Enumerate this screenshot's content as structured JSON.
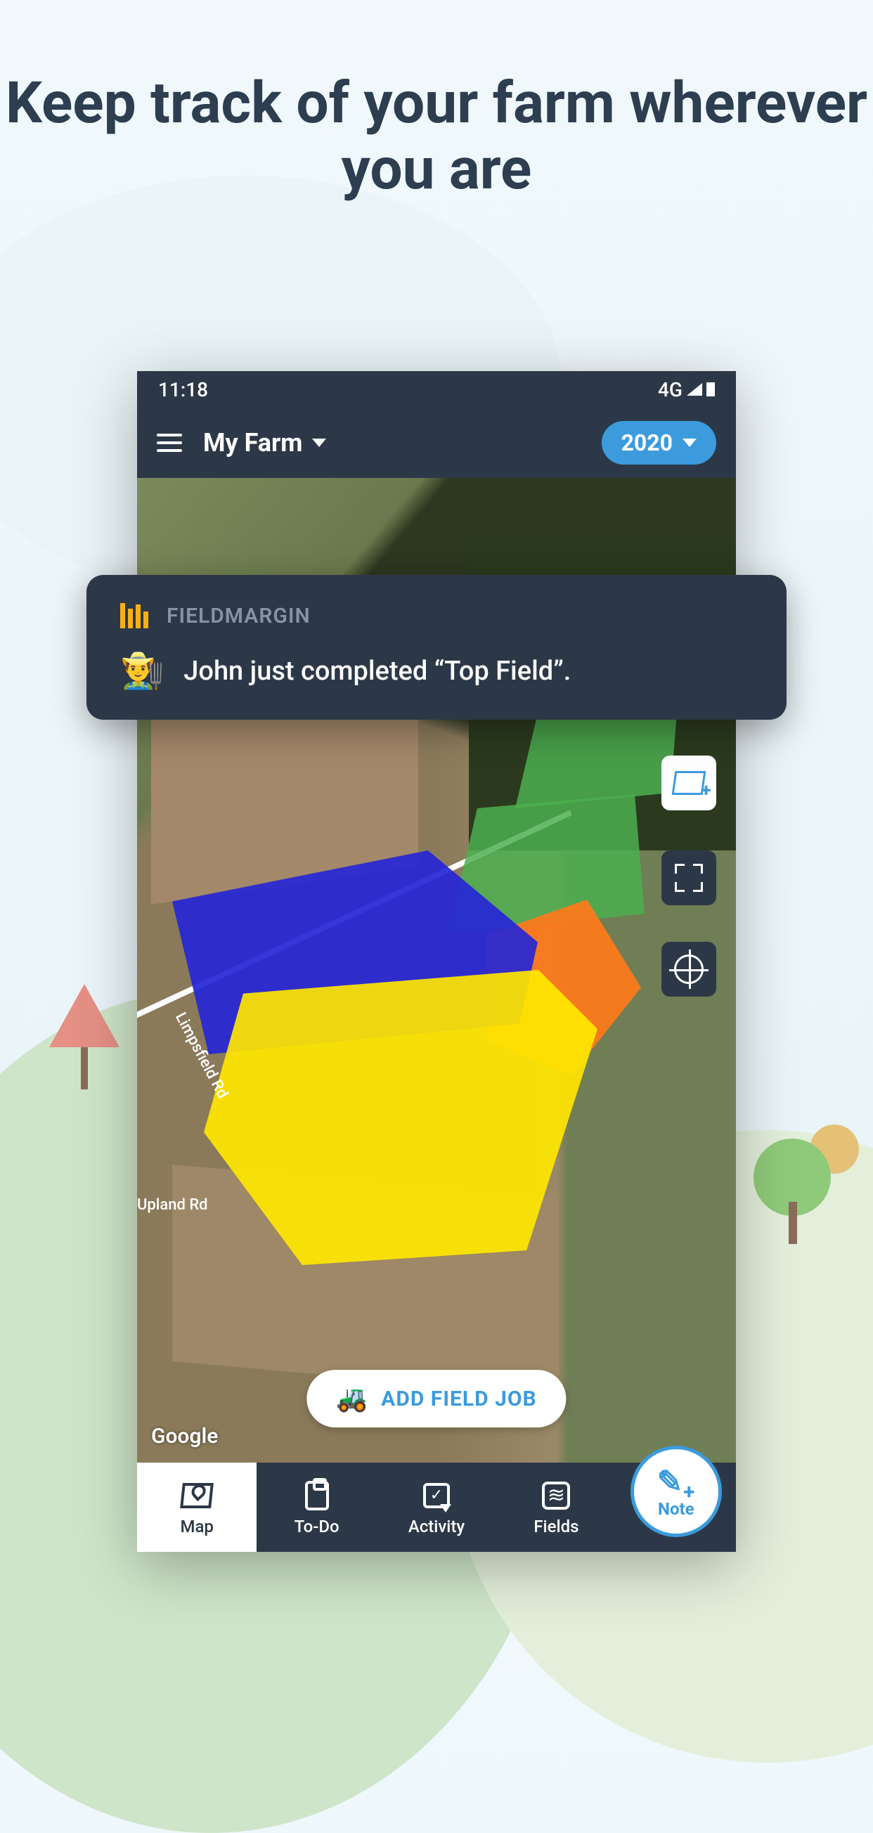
{
  "heading": "Keep track of your farm wherever you are",
  "status": {
    "time": "11:18",
    "network": "4G"
  },
  "header": {
    "farm_name": "My Farm",
    "year": "2020"
  },
  "map": {
    "road_labels": [
      "Limpsfield Rd",
      "Upland Rd"
    ],
    "attribution": "Google",
    "add_job_label": "ADD FIELD JOB",
    "controls": {
      "add_map": "add-map-layer",
      "expand": "expand",
      "target": "locate-me"
    },
    "field_colors": {
      "green": "#4caf50",
      "orange": "#ff7a1a",
      "blue": "#2626d6",
      "yellow": "#ffe600"
    }
  },
  "notification": {
    "brand": "FIELDMARGIN",
    "emoji": "👨‍🌾",
    "message": "John just completed “Top Field”."
  },
  "nav": {
    "items": [
      {
        "label": "Map",
        "active": true
      },
      {
        "label": "To-Do",
        "active": false
      },
      {
        "label": "Activity",
        "active": false
      },
      {
        "label": "Fields",
        "active": false
      }
    ],
    "note_label": "Note"
  }
}
